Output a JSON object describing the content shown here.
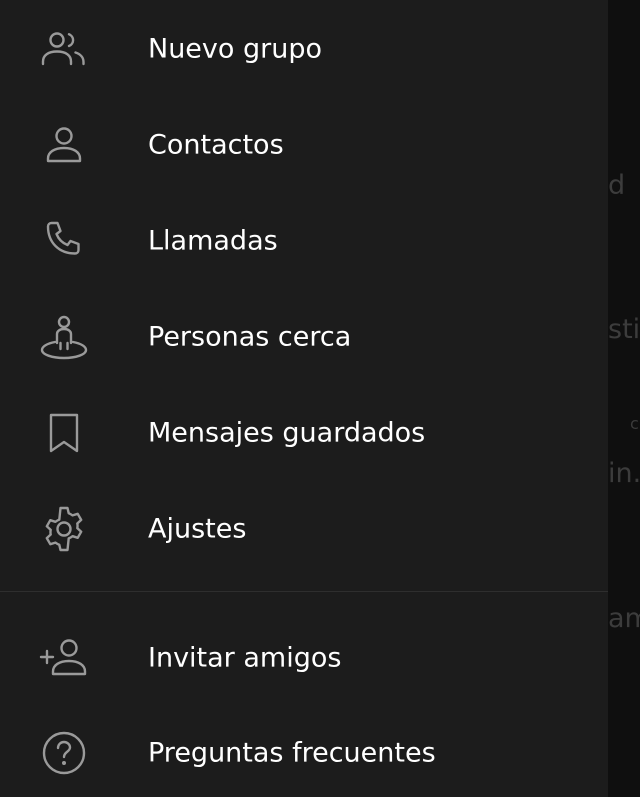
{
  "drawer": {
    "items": [
      {
        "label": "Nuevo grupo",
        "icon": "group-icon"
      },
      {
        "label": "Contactos",
        "icon": "person-icon"
      },
      {
        "label": "Llamadas",
        "icon": "phone-icon"
      },
      {
        "label": "Personas cerca",
        "icon": "people-nearby-icon"
      },
      {
        "label": "Mensajes guardados",
        "icon": "bookmark-icon"
      },
      {
        "label": "Ajustes",
        "icon": "gear-icon"
      }
    ],
    "secondary_items": [
      {
        "label": "Invitar amigos",
        "icon": "add-user-icon"
      },
      {
        "label": "Preguntas frecuentes",
        "icon": "help-icon"
      }
    ]
  },
  "background": {
    "fragments": [
      "d",
      "sti.",
      "c",
      "in.",
      "am"
    ]
  },
  "colors": {
    "drawer_bg": "#1c1c1c",
    "text": "#ffffff",
    "icon": "#9a9a9a",
    "divider": "#2e2e2e"
  }
}
